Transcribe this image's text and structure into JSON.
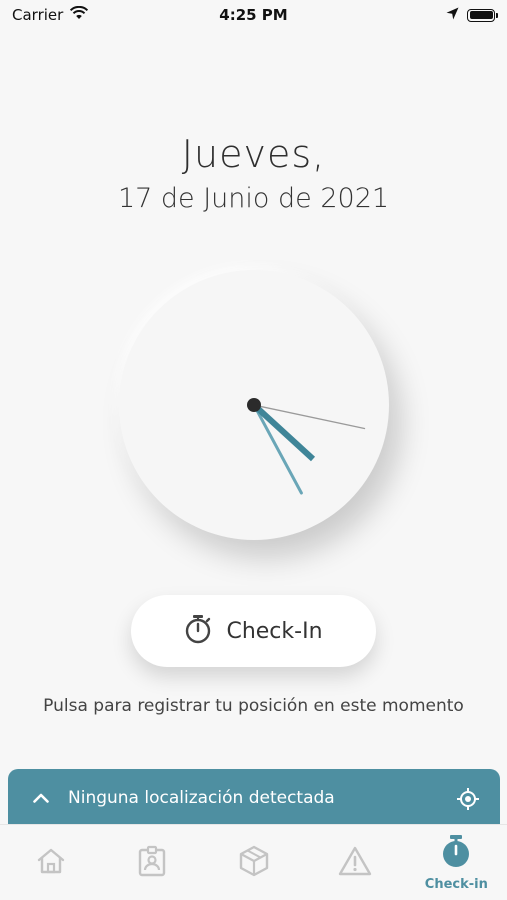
{
  "status_bar": {
    "carrier": "Carrier",
    "time": "4:25 PM"
  },
  "date": {
    "weekday": "Jueves,",
    "full_date": "17 de Junio de 2021"
  },
  "clock": {
    "hour": 4,
    "minute": 25,
    "second": 17,
    "hand_color": "#4e8fa1"
  },
  "checkin": {
    "button_label": "Check-In",
    "icon": "stopwatch-icon",
    "hint": "Pulsa para registrar tu posición en este momento"
  },
  "location": {
    "message": "Ninguna localización detectada",
    "left_icon": "chevron-up-icon",
    "right_icon": "target-icon",
    "background": "#4e8fa1"
  },
  "tab_bar": {
    "tabs": [
      {
        "icon": "home-icon",
        "label": ""
      },
      {
        "icon": "badge-icon",
        "label": ""
      },
      {
        "icon": "box-icon",
        "label": ""
      },
      {
        "icon": "warning-icon",
        "label": ""
      },
      {
        "icon": "stopwatch-icon",
        "label": "Check-in",
        "active": true
      }
    ],
    "active_color": "#4e8fa1",
    "inactive_color": "#c4c4c4"
  }
}
